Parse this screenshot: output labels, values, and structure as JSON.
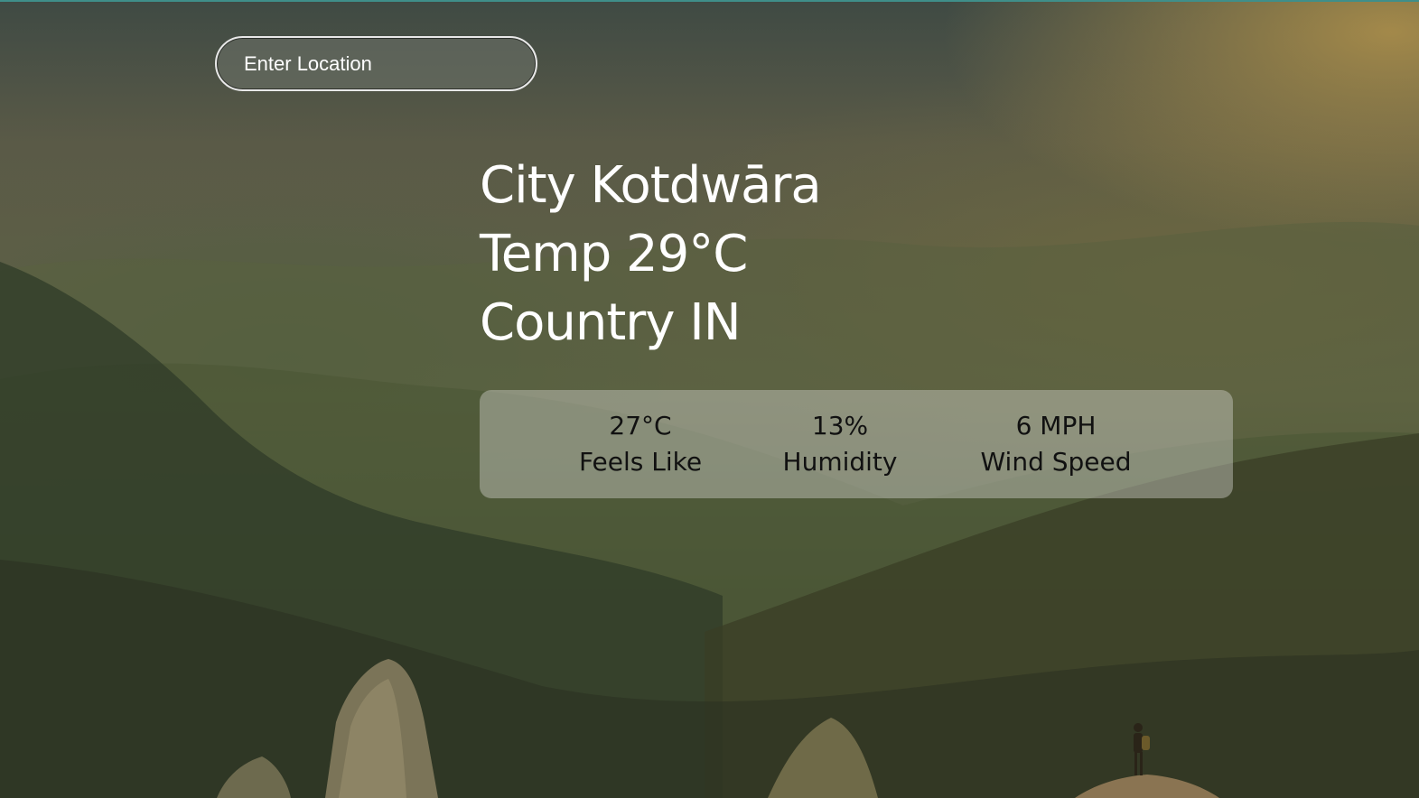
{
  "search": {
    "placeholder": "Enter Location"
  },
  "weather": {
    "city": "City Kotdwāra",
    "temp": "Temp 29°C",
    "country": "Country IN"
  },
  "details": {
    "feels_like": {
      "value": "27°C",
      "label": "Feels Like"
    },
    "humidity": {
      "value": "13%",
      "label": "Humidity"
    },
    "wind_speed": {
      "value": "6 MPH",
      "label": "Wind Speed"
    }
  }
}
